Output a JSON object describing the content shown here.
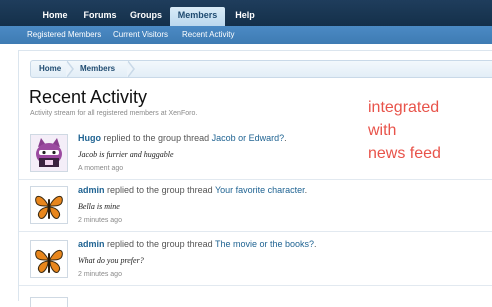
{
  "nav": {
    "tabs": [
      {
        "label": "Home",
        "active": false
      },
      {
        "label": "Forums",
        "active": false
      },
      {
        "label": "Groups",
        "active": false
      },
      {
        "label": "Members",
        "active": true
      },
      {
        "label": "Help",
        "active": false
      }
    ],
    "sub_links": [
      "Registered Members",
      "Current Visitors",
      "Recent Activity"
    ]
  },
  "breadcrumb": [
    "Home",
    "Members"
  ],
  "page": {
    "title": "Recent Activity",
    "description": "Activity stream for all registered members at XenForo."
  },
  "annotation": [
    "integrated",
    "with",
    "news feed"
  ],
  "activity": [
    {
      "user": "Hugo",
      "action": "replied to the group thread",
      "thread": "Jacob or Edward?",
      "thread_suffix": ".",
      "snippet": "Jacob is furrier and huggable",
      "time": "A moment ago",
      "avatar": "cat-avatar-icon"
    },
    {
      "user": "admin",
      "action": "replied to the group thread",
      "thread": "Your favorite character",
      "thread_suffix": ".",
      "snippet": "Bella is mine",
      "time": "2 minutes ago",
      "avatar": "butterfly-avatar-icon"
    },
    {
      "user": "admin",
      "action": "replied to the group thread",
      "thread": "The movie or the books?",
      "thread_suffix": ".",
      "snippet": "What do you prefer?",
      "time": "2 minutes ago",
      "avatar": "butterfly-avatar-icon"
    }
  ],
  "colors": {
    "nav_dark": "#1f3d5c",
    "nav_sub": "#4b8ac4",
    "link": "#1f6392",
    "annotation": "#e8534a"
  }
}
